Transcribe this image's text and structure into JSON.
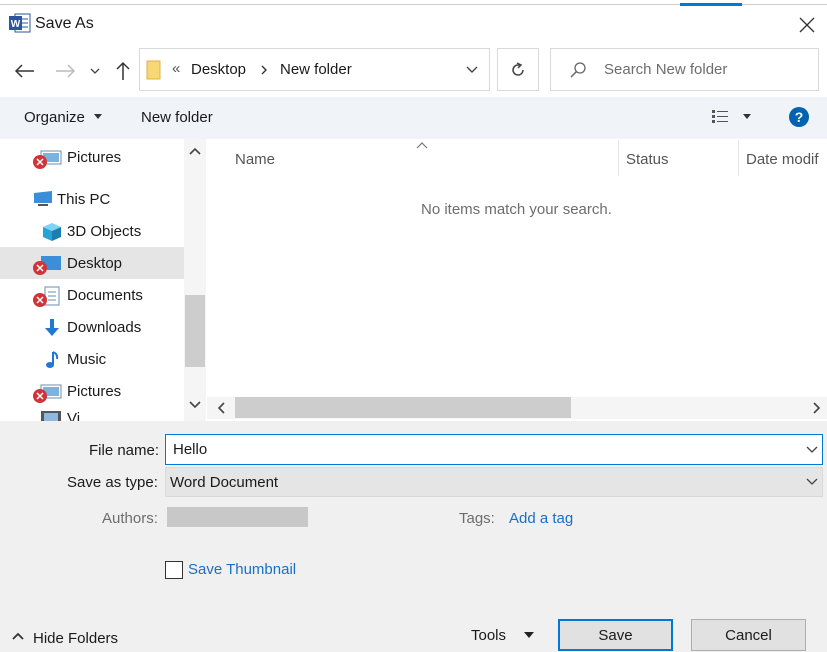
{
  "window": {
    "title": "Save As",
    "app_icon": "word-icon",
    "accent_color": "#0078d7"
  },
  "address_bar": {
    "overflow_chevron": "«",
    "path": [
      "Desktop",
      "New folder"
    ]
  },
  "search": {
    "placeholder": "Search New folder"
  },
  "command_bar": {
    "organize_label": "Organize",
    "new_folder_label": "New folder"
  },
  "nav_pane": {
    "items": [
      {
        "label": "Pictures",
        "icon": "pictures-icon",
        "error": true
      },
      {
        "label": "This PC",
        "icon": "pc-icon",
        "error": false
      },
      {
        "label": "3D Objects",
        "icon": "3d-objects-icon",
        "error": false
      },
      {
        "label": "Desktop",
        "icon": "desktop-icon",
        "error": true,
        "selected": true
      },
      {
        "label": "Documents",
        "icon": "documents-icon",
        "error": true
      },
      {
        "label": "Downloads",
        "icon": "downloads-icon",
        "error": false
      },
      {
        "label": "Music",
        "icon": "music-icon",
        "error": false
      },
      {
        "label": "Pictures",
        "icon": "pictures-icon",
        "error": true
      },
      {
        "label": "Vi",
        "icon": "videos-icon",
        "error": false
      }
    ]
  },
  "file_list": {
    "columns": [
      "Name",
      "Status",
      "Date modif"
    ],
    "empty_message": "No items match your search."
  },
  "form": {
    "file_name_label": "File name:",
    "file_name_value": "Hello",
    "save_as_type_label": "Save as type:",
    "save_as_type_value": "Word Document",
    "authors_label": "Authors:",
    "tags_label": "Tags:",
    "tags_link": "Add a tag",
    "save_thumbnail_label": "Save Thumbnail",
    "save_thumbnail_checked": false
  },
  "footer": {
    "hide_folders_label": "Hide Folders",
    "tools_label": "Tools",
    "save_label": "Save",
    "cancel_label": "Cancel"
  }
}
